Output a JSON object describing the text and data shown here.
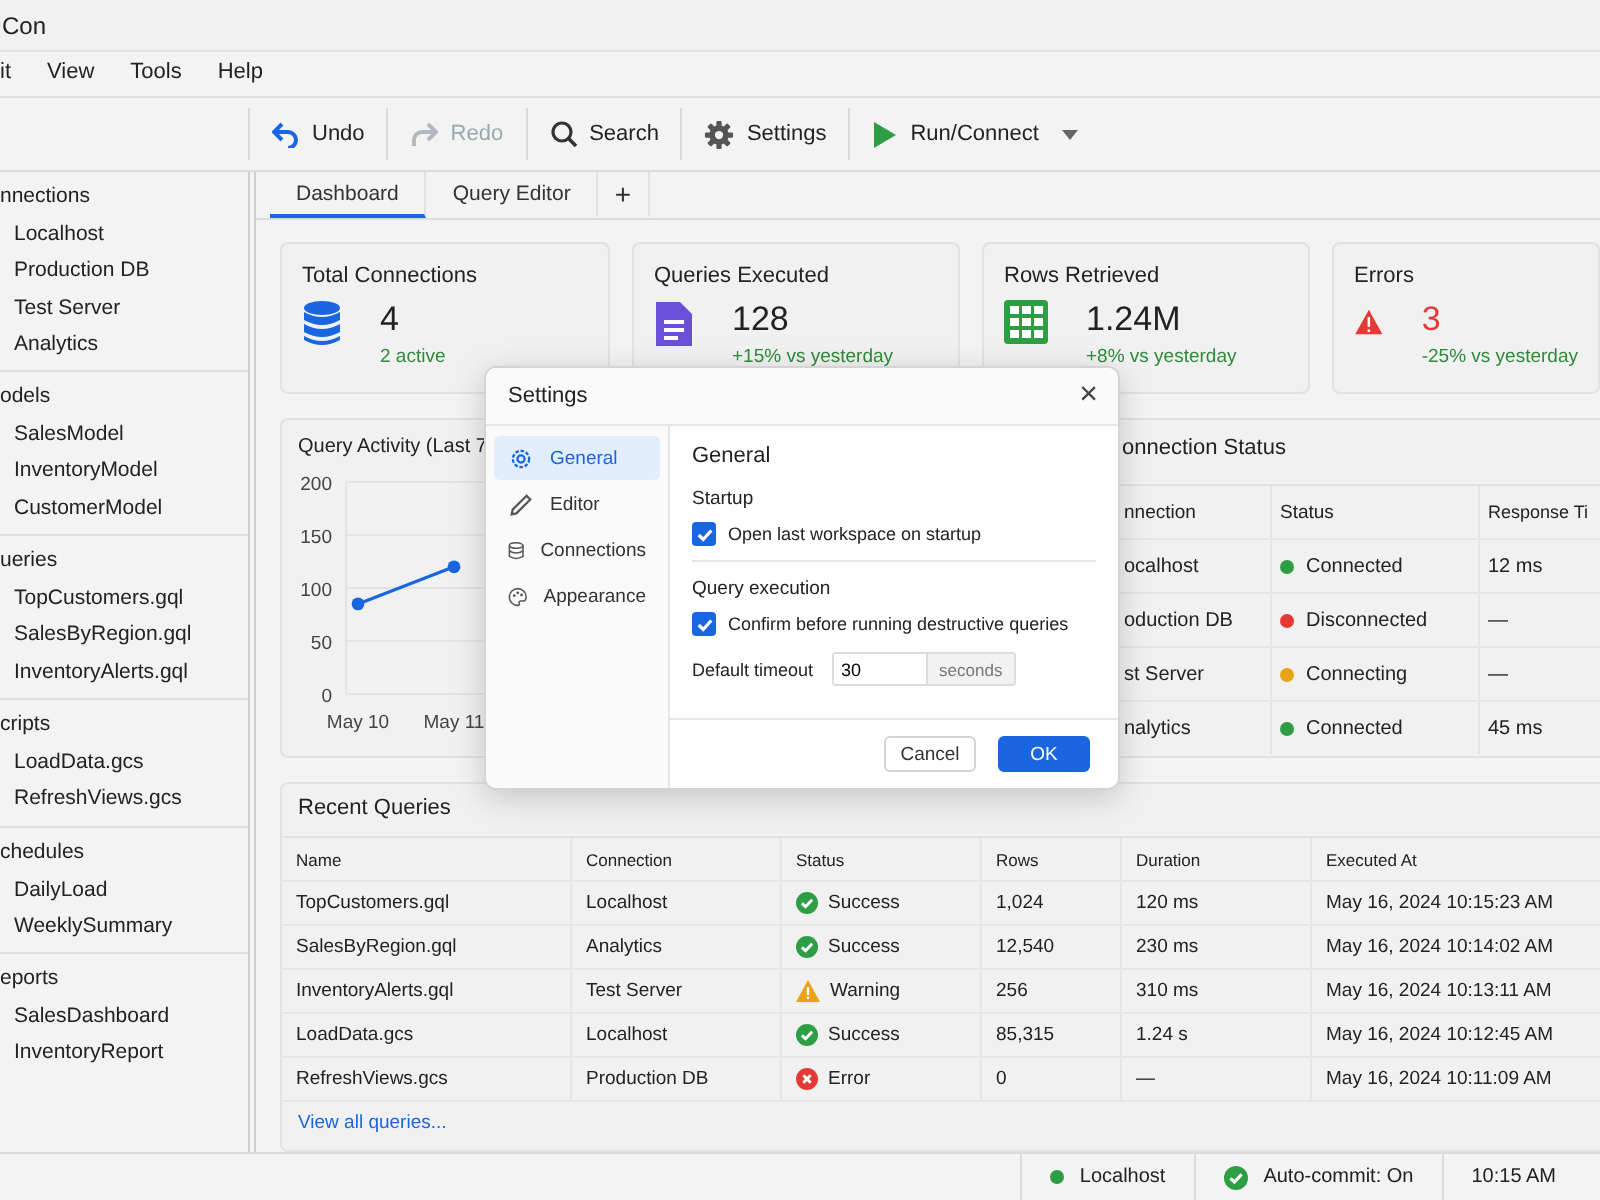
{
  "window": {
    "title": "Con"
  },
  "menu": [
    "it",
    "View",
    "Tools",
    "Help"
  ],
  "toolbar": [
    {
      "label": "Undo",
      "disabled": false,
      "dropdown": false
    },
    {
      "label": "Redo",
      "disabled": true,
      "dropdown": false
    },
    {
      "label": "Search",
      "disabled": false,
      "dropdown": false
    },
    {
      "label": "Settings",
      "disabled": false,
      "dropdown": false
    },
    {
      "label": "Run/Connect",
      "disabled": false,
      "dropdown": true
    }
  ],
  "sidebar": {
    "groups": [
      {
        "title": "nnections",
        "items": [
          "Localhost",
          "Production DB",
          "Test Server",
          "Analytics"
        ]
      },
      {
        "title": "odels",
        "items": [
          "SalesModel",
          "InventoryModel",
          "CustomerModel"
        ]
      },
      {
        "title": "ueries",
        "items": [
          "TopCustomers.gql",
          "SalesByRegion.gql",
          "InventoryAlerts.gql"
        ]
      },
      {
        "title": "cripts",
        "items": [
          "LoadData.gcs",
          "RefreshViews.gcs"
        ]
      },
      {
        "title": "chedules",
        "items": [
          "DailyLoad",
          "WeeklySummary"
        ]
      },
      {
        "title": "eports",
        "items": [
          "SalesDashboard",
          "InventoryReport"
        ]
      }
    ]
  },
  "tabs": [
    {
      "label": "Dashboard",
      "selected": true
    },
    {
      "label": "Query Editor",
      "selected": false
    }
  ],
  "add_tab": "+",
  "cards": [
    {
      "title": "Total Connections",
      "value": "4",
      "note": "2 active",
      "alert": false
    },
    {
      "title": "Queries Executed",
      "value": "128",
      "note": "+15% vs yesterday",
      "alert": false
    },
    {
      "title": "Rows Retrieved",
      "value": "1.24M",
      "note": "+8% vs yesterday",
      "alert": false
    },
    {
      "title": "Errors",
      "value": "3",
      "note": "-25% vs yesterday",
      "alert": true
    }
  ],
  "activity": {
    "title": "Query Activity (Last 7",
    "chart_data": {
      "type": "line",
      "categories": [
        "May 10",
        "May 11"
      ],
      "series": [
        {
          "color": "#1a66e0",
          "values": [
            85,
            120
          ],
          "marker": "circle"
        }
      ],
      "ylim": [
        0,
        200
      ],
      "yticks": [
        0,
        50,
        100,
        150,
        200
      ],
      "grid": true
    }
  },
  "connection_status": {
    "title": "onnection Status",
    "columns": [
      "nnection",
      "Status",
      "Response Ti"
    ],
    "rows": [
      {
        "connection": "ocalhost",
        "status": "Connected",
        "color": "#2e9e44",
        "response": "12 ms"
      },
      {
        "connection": "oduction DB",
        "status": "Disconnected",
        "color": "#e53935",
        "response": "—"
      },
      {
        "connection": "st Server",
        "status": "Connecting",
        "color": "#e8a317",
        "response": "—"
      },
      {
        "connection": "nalytics",
        "status": "Connected",
        "color": "#2e9e44",
        "response": "45 ms"
      }
    ]
  },
  "recent": {
    "title": "Recent Queries",
    "columns": [
      "Name",
      "Connection",
      "Status",
      "Rows",
      "Duration",
      "Executed At"
    ],
    "rows": [
      {
        "name": "TopCustomers.gql",
        "connection": "Localhost",
        "status": "Success",
        "kind": "success",
        "rows": "1,024",
        "duration": "120 ms",
        "executed": "May 16, 2024 10:15:23 AM"
      },
      {
        "name": "SalesByRegion.gql",
        "connection": "Analytics",
        "status": "Success",
        "kind": "success",
        "rows": "12,540",
        "duration": "230 ms",
        "executed": "May 16, 2024 10:14:02 AM"
      },
      {
        "name": "InventoryAlerts.gql",
        "connection": "Test Server",
        "status": "Warning",
        "kind": "warning",
        "rows": "256",
        "duration": "310 ms",
        "executed": "May 16, 2024 10:13:11 AM"
      },
      {
        "name": "LoadData.gcs",
        "connection": "Localhost",
        "status": "Success",
        "kind": "success",
        "rows": "85,315",
        "duration": "1.24 s",
        "executed": "May 16, 2024 10:12:45 AM"
      },
      {
        "name": "RefreshViews.gcs",
        "connection": "Production DB",
        "status": "Error",
        "kind": "error",
        "rows": "0",
        "duration": "—",
        "executed": "May 16, 2024 10:11:09 AM"
      }
    ],
    "link": "View all queries..."
  },
  "status_bar": [
    {
      "kind": "dot",
      "text": "Localhost",
      "color": "#2e9e44"
    },
    {
      "kind": "check",
      "text": "Auto-commit: On"
    },
    {
      "kind": "plain",
      "text": "10:15 AM"
    }
  ],
  "dialog": {
    "title": "Settings",
    "close": "×",
    "nav": [
      {
        "label": "General",
        "selected": true
      },
      {
        "label": "Editor",
        "selected": false
      },
      {
        "label": "Connections",
        "selected": false
      },
      {
        "label": "Appearance",
        "selected": false
      }
    ],
    "heading": "General",
    "sections": [
      {
        "title": "Startup",
        "checks": [
          {
            "label": "Open last workspace on startup",
            "checked": true
          }
        ]
      },
      {
        "title": "Query execution",
        "checks": [
          {
            "label": "Confirm before running destructive queries",
            "checked": true
          }
        ],
        "field": {
          "label": "Default timeout",
          "value": "30",
          "unit": "seconds"
        }
      }
    ],
    "buttons": [
      {
        "label": "Cancel",
        "primary": false
      },
      {
        "label": "OK",
        "primary": true
      }
    ]
  }
}
